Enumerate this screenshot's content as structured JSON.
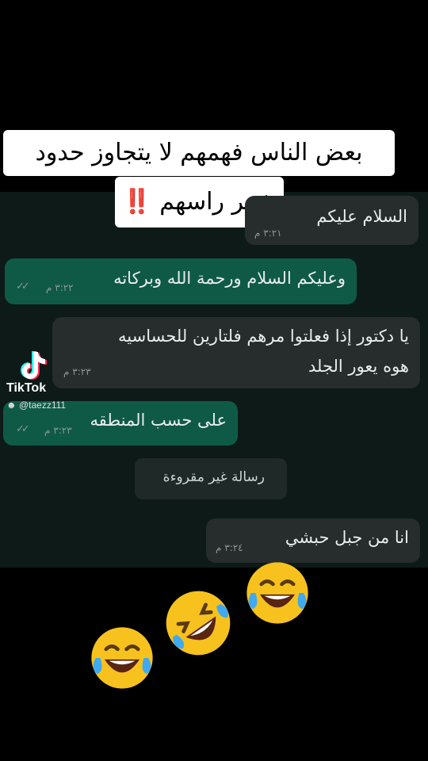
{
  "caption": {
    "line1": "بعض الناس فهمهم لا يتجاوز حدود",
    "line2": "شعر راسهم ‼️"
  },
  "messages": [
    {
      "text": "السلام عليكم",
      "time": "٣:٢١ م"
    },
    {
      "text": "وعليكم السلام  ورحمة الله وبركاته",
      "time": "٣:٢٢ م",
      "ticks": "✓✓"
    },
    {
      "line1": "يا دكتور إذا فعلتوا مرهم فلتارين للحساسيه",
      "line2": "هوه يعور الجلد",
      "time": "٣:٢٣ م"
    },
    {
      "text": "على حسب المنطقه",
      "time": "٣:٢٣ م",
      "ticks": "✓✓"
    },
    {
      "text": "رسالة غير مقروءة"
    },
    {
      "text": "انا من جبل حبشي",
      "time": "٣:٢٤ م"
    }
  ],
  "tiktok": {
    "name": "TikTok",
    "user": "@taezz111"
  },
  "emojis": [
    "face-with-tears-of-joy",
    "rolling-on-floor-laughing",
    "face-with-tears-of-joy"
  ],
  "colors": {
    "incoming": "#262d2c",
    "outgoing": "#0f5a47",
    "chat_bg": "#0d1a17"
  }
}
